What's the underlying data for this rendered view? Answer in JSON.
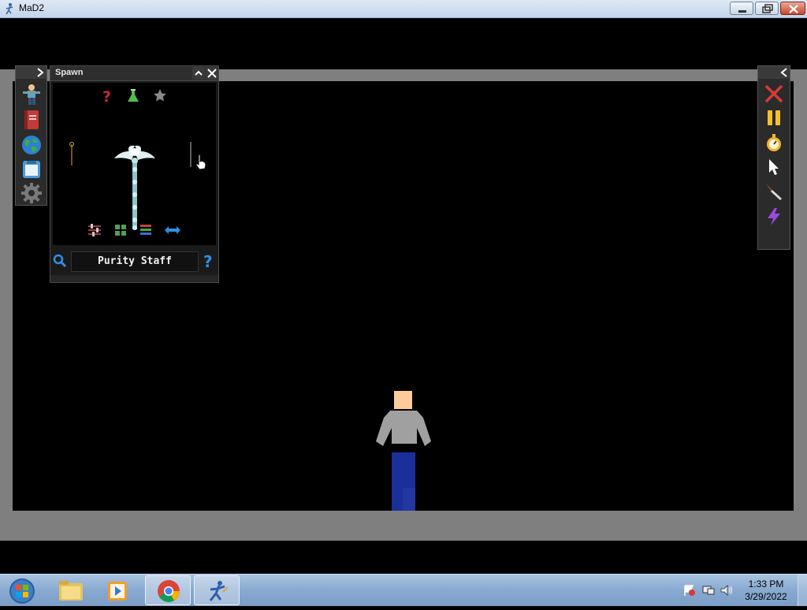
{
  "window": {
    "title": "MaD2"
  },
  "spawn_panel": {
    "title": "Spawn",
    "item_name": "Purity Staff"
  },
  "left_toolbar": {
    "items": [
      "character-icon",
      "book-icon",
      "globe-icon",
      "save-icon",
      "gear-icon"
    ]
  },
  "right_toolbar": {
    "items": [
      "delete-x-icon",
      "pause-icon",
      "stopwatch-icon",
      "pointer-icon",
      "knife-icon",
      "lightning-icon"
    ]
  },
  "taskbar": {
    "time": "1:33 PM",
    "date": "3/29/2022"
  },
  "colors": {
    "frame": "#7f7f7f",
    "skin": "#ffcc99",
    "shirt": "#a0a0a0",
    "pants": "#1a2f99"
  }
}
